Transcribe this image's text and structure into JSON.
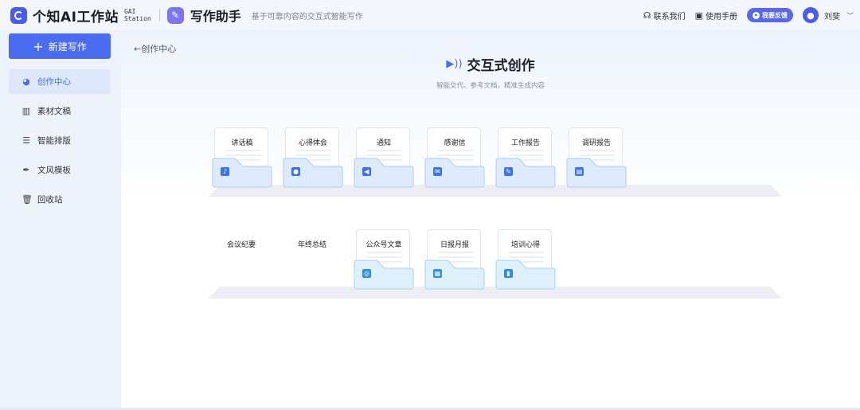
{
  "header": {
    "brand_name": "个知AI工作站",
    "brand_sub_line1": "GAI",
    "brand_sub_line2": "Station",
    "app_name": "写作助手",
    "app_desc": "基于可靠内容的交互式智能写作",
    "contact": "联系我们",
    "manual": "使用手册",
    "feedback": "我要反馈",
    "username": "刘斐"
  },
  "sidebar": {
    "new_button": "新建写作",
    "items": [
      {
        "label": "创作中心",
        "icon": "pie-icon",
        "active": true
      },
      {
        "label": "素材文稿",
        "icon": "books-icon",
        "active": false
      },
      {
        "label": "智能排版",
        "icon": "layout-icon",
        "active": false
      },
      {
        "label": "文风模板",
        "icon": "pen-icon",
        "active": false
      },
      {
        "label": "回收站",
        "icon": "trash-icon",
        "active": false
      }
    ]
  },
  "main": {
    "back_label": "←创作中心",
    "title": "交互式创作",
    "subtitle": "智能交代、参考文档，精准生成内容",
    "row1": [
      {
        "label": "讲话稿",
        "icon": "mic-icon"
      },
      {
        "label": "心得体会",
        "icon": "person-icon"
      },
      {
        "label": "通知",
        "icon": "megaphone-icon"
      },
      {
        "label": "感谢信",
        "icon": "mail-icon"
      },
      {
        "label": "工作报告",
        "icon": "report-icon"
      },
      {
        "label": "调研报告",
        "icon": "clipboard-icon"
      }
    ],
    "row2_plain": [
      "会议纪要",
      "年终总结"
    ],
    "row2": [
      {
        "label": "公众号文章",
        "icon": "wechat-icon"
      },
      {
        "label": "日报月报",
        "icon": "calendar-icon"
      },
      {
        "label": "培训心得",
        "icon": "book-icon"
      }
    ]
  },
  "colors": {
    "accent": "#4a6cf0",
    "folder_fill": "#deebfc",
    "folder_stroke": "#a9cdf6"
  }
}
